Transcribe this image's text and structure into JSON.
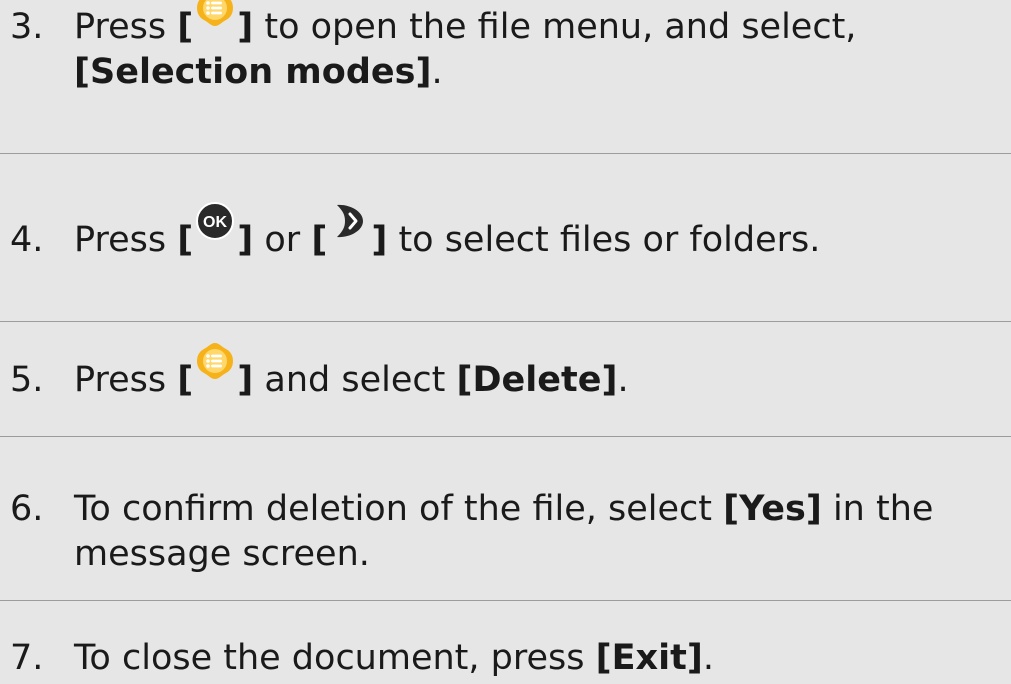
{
  "steps": [
    {
      "number": "3.",
      "text_1": "Press ",
      "bracket_open": "[",
      "icon": "menu-icon",
      "bracket_close": "]",
      "text_2": " to open the file menu, and select,",
      "bold_1": "[Selection modes]",
      "text_3": "."
    },
    {
      "number": "4.",
      "text_1": "Press ",
      "bracket_open": "[",
      "icon_1": "ok-button-icon",
      "bracket_close": "]",
      "text_2": " or ",
      "bracket_open_2": "[",
      "icon_2": "right-arrow-button-icon",
      "bracket_close_2": "]",
      "text_3": " to select files or folders."
    },
    {
      "number": "5.",
      "text_1": "Press ",
      "bracket_open": "[",
      "icon": "menu-icon",
      "bracket_close": "]",
      "text_2": " and select ",
      "bold_1": "[Delete]",
      "text_3": "."
    },
    {
      "number": "6.",
      "text_1": "To confirm deletion of the file, select ",
      "bold_1": "[Yes]",
      "text_2": " in the",
      "text_3": "message screen."
    },
    {
      "number": "7.",
      "text_1": "To close the document, press ",
      "bold_1": "[Exit]",
      "text_2": "."
    }
  ],
  "colors": {
    "background": "#e6e6e6",
    "divider": "#9c9c9c",
    "menu_icon_yellow": "#f6b21a",
    "button_icon_dark": "#2a2a2a"
  }
}
